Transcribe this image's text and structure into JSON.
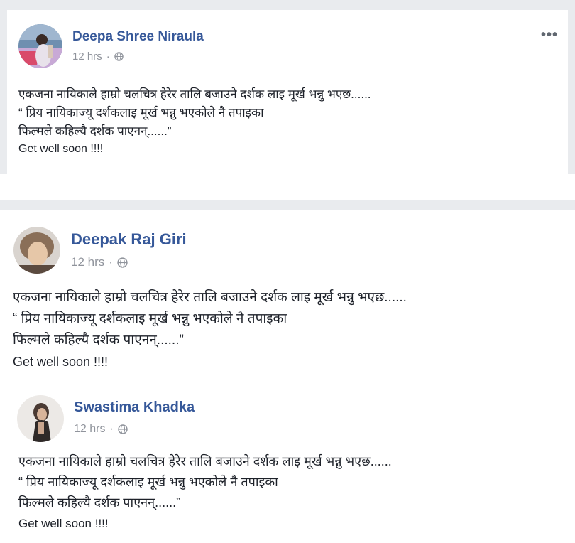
{
  "posts": [
    {
      "author": "Deepa Shree Niraula",
      "time": "12 hrs",
      "separator": "·",
      "lines": [
        "एकजना नायिकाले हाम्रो चलचित्र हेरेर तालि बजाउने दर्शक लाइ मूर्ख भन्नु भएछ......",
        "“ प्रिय नायिकाज्यू दर्शकलाइ मूर्ख भन्नु भएकोले नै तपाइका",
        "फिल्मले कहिल्यै दर्शक पाएनन्......”"
      ],
      "signoff": "Get well soon !!!!",
      "more_label": "•••"
    },
    {
      "author": "Deepak Raj Giri",
      "time": "12 hrs",
      "separator": "·",
      "lines": [
        "एकजना नायिकाले हाम्रो चलचित्र हेरेर तालि बजाउने दर्शक लाइ मूर्ख भन्नु भएछ......",
        "“ प्रिय नायिकाज्यू दर्शकलाइ मूर्ख भन्नु भएकोले नै तपाइका",
        "फिल्मले कहिल्यै दर्शक पाएनन्......”"
      ],
      "signoff": "Get well soon !!!!"
    },
    {
      "author": "Swastima Khadka",
      "time": "12 hrs",
      "separator": "·",
      "lines": [
        "एकजना नायिकाले हाम्रो चलचित्र हेरेर तालि बजाउने दर्शक लाइ मूर्ख भन्नु भएछ......",
        "“ प्रिय नायिकाज्यू दर्शकलाइ मूर्ख भन्नु भएकोले नै तपाइका",
        "फिल्मले कहिल्यै दर्शक पाएनन्......”"
      ],
      "signoff": "Get well soon !!!!"
    }
  ],
  "colors": {
    "name": "#365899",
    "meta": "#90949c",
    "text": "#1d2129",
    "feed_background": "#e9ebee"
  },
  "icons": {
    "privacy": "globe-icon",
    "options": "more-options-icon"
  }
}
